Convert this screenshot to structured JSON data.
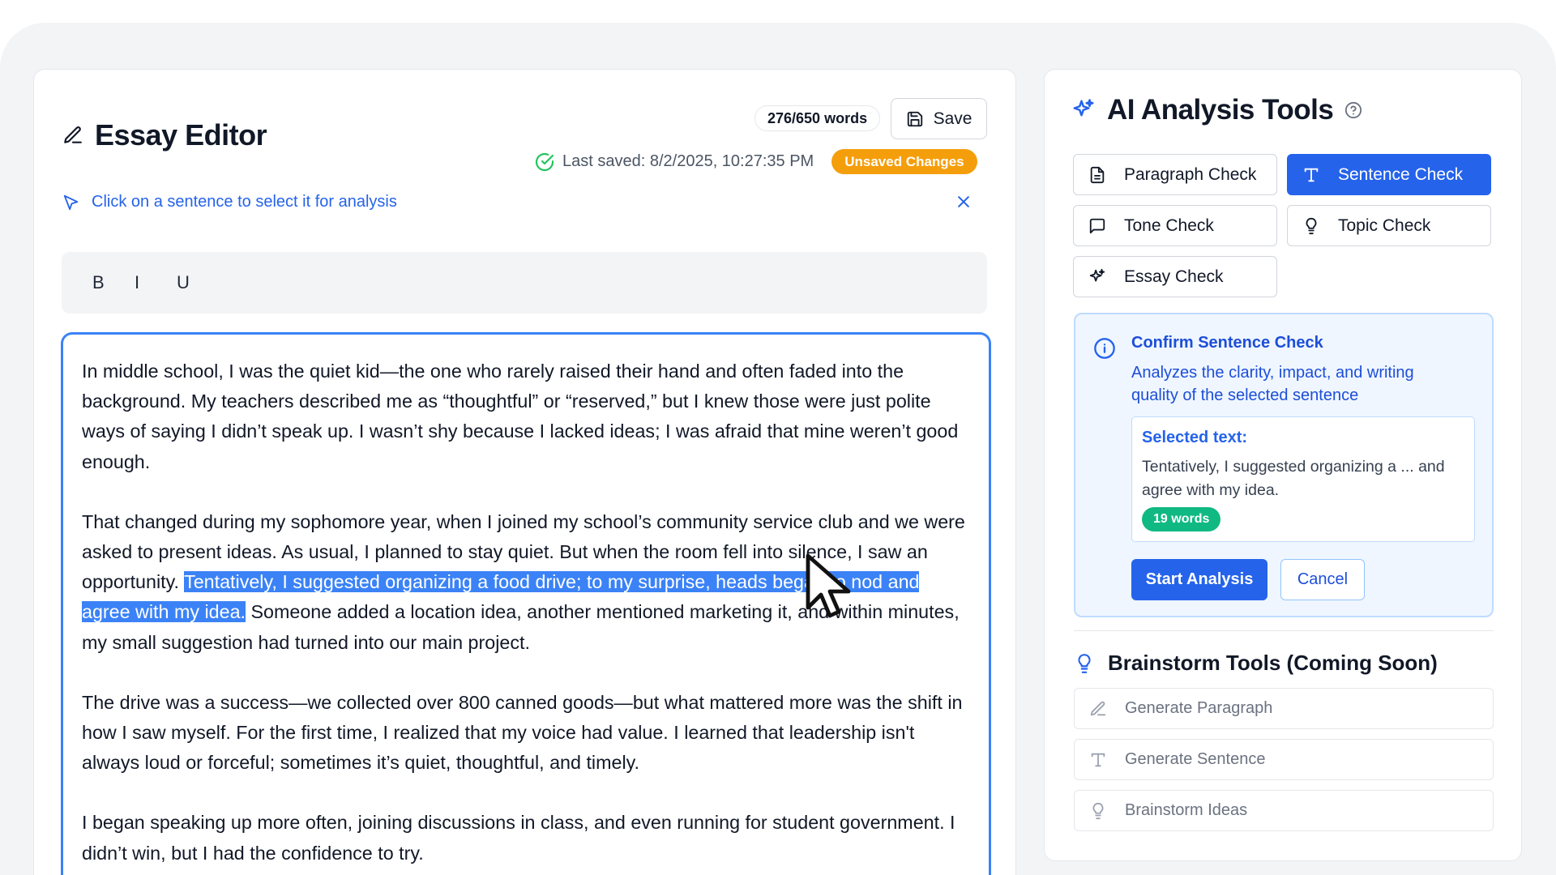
{
  "editor": {
    "title": "Essay Editor",
    "word_count": "276/650 words",
    "save_label": "Save",
    "last_saved": "Last saved: 8/2/2025, 10:27:35 PM",
    "unsaved_badge": "Unsaved Changes",
    "hint": "Click on a sentence to select it for analysis",
    "toolbar": {
      "bold": "B",
      "italic": "I",
      "underline": "U"
    },
    "paragraphs": [
      {
        "text": "In middle school, I was the quiet kid—the one who rarely raised their hand and often faded into the background. My teachers described me as “thoughtful” or “reserved,” but I knew those were just polite ways of saying I didn’t speak up. I wasn’t shy because I lacked ideas; I was afraid that mine weren’t good enough."
      },
      {
        "before": "That changed during my sophomore year, when I joined my school’s community service club and we were asked to present ideas. As usual, I planned to stay quiet. But when the room fell into silence, I saw an opportunity. ",
        "selected": "Tentatively, I suggested organizing a food drive; to my surprise, heads began to nod and agree with my idea.",
        "after": " Someone added a location idea, another mentioned marketing it, and within minutes, my small suggestion had turned into our main project."
      },
      {
        "text": "The drive was a success—we collected over 800 canned goods—but what mattered more was the shift in how I saw myself. For the first time, I realized that my voice had value. I learned that leadership isn't always loud or forceful; sometimes it’s quiet, thoughtful, and timely."
      },
      {
        "text": "I began speaking up more often, joining discussions in class, and even running for student government. I didn’t win, but I had the confidence to try."
      }
    ]
  },
  "ai_panel": {
    "title": "AI Analysis Tools",
    "tools": {
      "paragraph": "Paragraph Check",
      "sentence": "Sentence Check",
      "tone": "Tone Check",
      "topic": "Topic Check",
      "essay": "Essay Check"
    },
    "active_tool": "Sentence Check",
    "confirm": {
      "title": "Confirm Sentence Check",
      "description": "Analyzes the clarity, impact, and writing quality of the selected sentence",
      "selected_label": "Selected text:",
      "selected_text": "Tentatively, I suggested organizing a ... and agree with my idea.",
      "word_badge": "19 words",
      "start_label": "Start Analysis",
      "cancel_label": "Cancel"
    },
    "brainstorm": {
      "title": "Brainstorm Tools (Coming Soon)",
      "items": {
        "paragraph": "Generate Paragraph",
        "sentence": "Generate Sentence",
        "ideas": "Brainstorm Ideas"
      }
    }
  },
  "colors": {
    "accent": "#2563eb",
    "selection": "#3b82f6",
    "warning": "#f59e0b",
    "success": "#10b981"
  }
}
